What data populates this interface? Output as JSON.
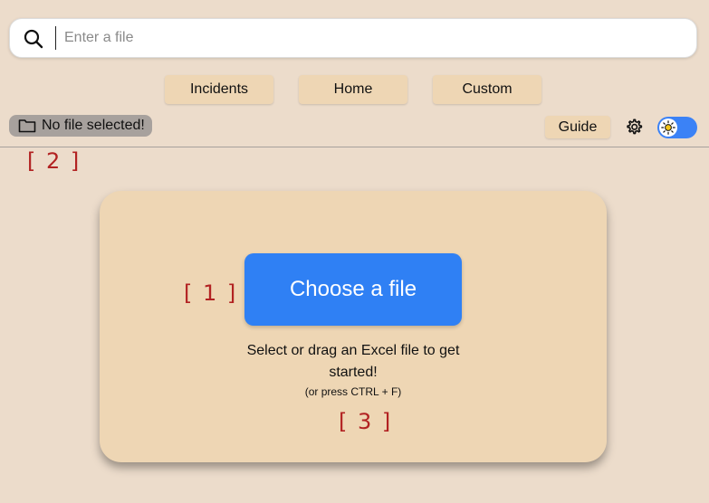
{
  "search": {
    "placeholder": "Enter a file",
    "icon": "search-icon"
  },
  "nav": {
    "items": [
      {
        "label": "Incidents"
      },
      {
        "label": "Home"
      },
      {
        "label": "Custom"
      }
    ]
  },
  "file_status": {
    "label": "No file selected!",
    "icon": "folder-icon"
  },
  "toolbar": {
    "guide_label": "Guide",
    "settings_icon": "gear-icon",
    "theme_toggle": {
      "icon": "sun-icon",
      "state": "on",
      "color": "#3b82f6"
    }
  },
  "markers": {
    "m1": "[ 1 ]",
    "m2": "[ 2 ]",
    "m3": "[ 3 ]"
  },
  "upload": {
    "button_label": "Choose a file",
    "helper_text": "Select or drag an Excel file to get started!",
    "hint": "(or press CTRL + F)"
  },
  "colors": {
    "background": "#ecdccb",
    "card": "#eed6b4",
    "accent": "#2f80f4",
    "marker": "#b22222"
  }
}
